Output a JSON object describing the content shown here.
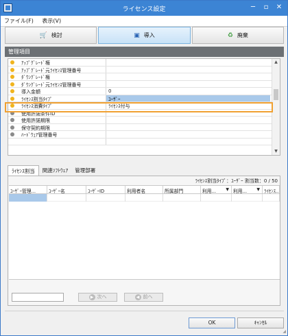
{
  "window": {
    "title": "ライセンス設定",
    "minimize": "─",
    "restore": "▫",
    "close": "✕"
  },
  "menu": [
    {
      "label": "ファイル(F)"
    },
    {
      "label": "表示(V)"
    }
  ],
  "toolbar": [
    {
      "label": "検討",
      "icon": "🛒",
      "active": false
    },
    {
      "label": "導入",
      "icon": "▣",
      "active": true
    },
    {
      "label": "廃棄",
      "icon": "♻",
      "active": false
    }
  ],
  "section": {
    "title": "管理項目"
  },
  "properties": [
    {
      "name": "ｱｯﾌﾟｸﾞﾚｰﾄﾞ権",
      "value": "",
      "color": "#f0b41e"
    },
    {
      "name": "ｱｯﾌﾟｸﾞﾚｰﾄﾞ元ﾗｲｾﾝｽ管理番号",
      "value": "",
      "color": "#f0b41e"
    },
    {
      "name": "ﾀﾞｳﾝｸﾞﾚｰﾄﾞ権",
      "value": "",
      "color": "#f0b41e"
    },
    {
      "name": "ﾀﾞｳﾝｸﾞﾚｰﾄﾞ元ﾗｲｾﾝｽ管理番号",
      "value": "",
      "color": "#f0b41e"
    },
    {
      "name": "導入金額",
      "value": "0",
      "color": "#f0b41e"
    },
    {
      "name": "ﾗｲｾﾝｽ割当ﾀｲﾌﾟ",
      "value": "ﾕｰｻﾞｰ",
      "color": "#f0b41e",
      "selected": true
    },
    {
      "name": "ﾗｲｾﾝｽ消費ﾀｲﾌﾟ",
      "value": "ﾗｲｾﾝｽ付与",
      "color": "#f0b41e"
    },
    {
      "name": "使用許諾条件ID",
      "value": "",
      "color": "#8a8a8a"
    },
    {
      "name": "使用許諾期限",
      "value": "",
      "color": "#8a8a8a"
    },
    {
      "name": "保守契約期限",
      "value": "",
      "color": "#8a8a8a"
    },
    {
      "name": "ﾊｰﾄﾞｳｪｱ管理番号",
      "value": "",
      "color": "#8a8a8a"
    },
    {
      "name": "",
      "value": "",
      "color": ""
    }
  ],
  "tabs": [
    {
      "label": "ﾗｲｾﾝｽ割当",
      "active": true
    },
    {
      "label": "関連ｿﾌﾄｳｪｱ",
      "active": false
    },
    {
      "label": "管理部署",
      "active": false
    }
  ],
  "assignment": {
    "summary": "ﾗｲｾﾝｽ割当ﾀｲﾌﾟ：ﾕｰｻﾞｰ  割当数：0 / 50"
  },
  "table": {
    "columns": [
      {
        "label": "ﾕｰｻﾞｰ管理..."
      },
      {
        "label": "ﾕｰｻﾞｰ名"
      },
      {
        "label": "ﾕｰｻﾞｰID"
      },
      {
        "label": "利用者名"
      },
      {
        "label": "所属部門"
      },
      {
        "label": "利用...",
        "sort": "▼"
      },
      {
        "label": "利用...",
        "sort": "▼"
      },
      {
        "label": "ﾗｲｾﾝｽ..."
      }
    ]
  },
  "pager": {
    "next": "次へ",
    "prev": "前へ"
  },
  "footer": {
    "ok": "OK",
    "cancel": "ｷｬﾝｾﾙ"
  }
}
